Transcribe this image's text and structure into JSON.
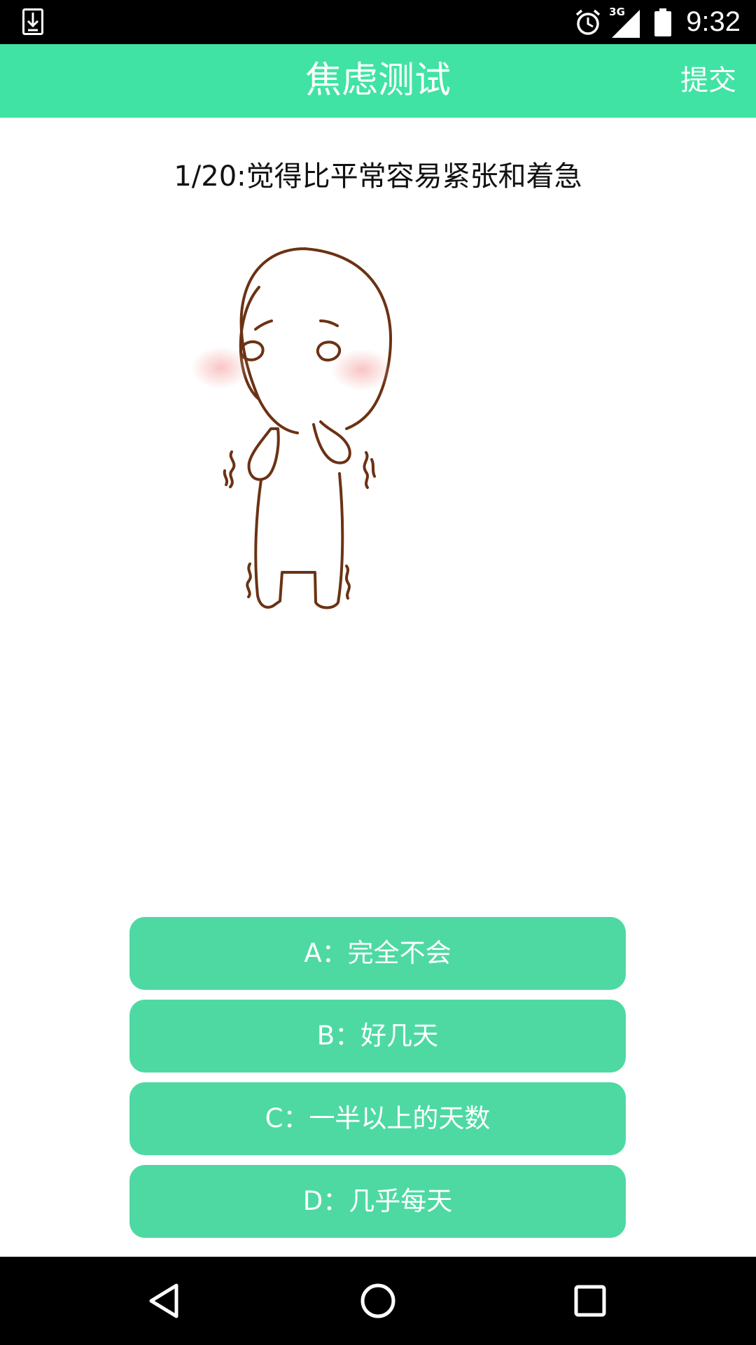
{
  "status_bar": {
    "network": "3G",
    "time": "9:32",
    "icons": [
      "download-icon",
      "alarm-icon",
      "signal-icon",
      "battery-icon"
    ]
  },
  "app_bar": {
    "title": "焦虑测试",
    "submit_label": "提交",
    "color": "#40e3a3"
  },
  "question": {
    "text": "1/20:觉得比平常容易紧张和着急"
  },
  "options": [
    {
      "label": "A：完全不会"
    },
    {
      "label": "B：好几天"
    },
    {
      "label": "C：一半以上的天数"
    },
    {
      "label": "D：几乎每天"
    }
  ],
  "option_color": "#4ed9a3",
  "nav_bar": {
    "icons": [
      "back-icon",
      "home-icon",
      "recents-icon"
    ]
  }
}
